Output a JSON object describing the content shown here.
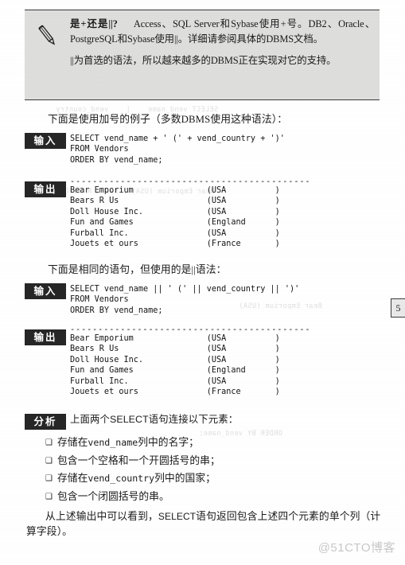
{
  "note": {
    "icon": "pencil-icon",
    "title": "是+还是||?",
    "paragraph_1": "Access、SQL Server和Sybase使用+号。DB2、Oracle、PostgreSQL和Sybase使用||。详细请参阅具体的DBMS文档。",
    "paragraph_2": "||为首选的语法，所以越来越多的DBMS正在实现对它的支持。",
    "background_color": "#dededd"
  },
  "sections": [
    {
      "intro": "下面是使用加号的例子（多数DBMS使用这种语法）：",
      "input_label": "输入",
      "input_code": "SELECT vend_name + ' (' + vend_country + ')'\nFROM Vendors\nORDER BY vend_name;",
      "output_label": "输出",
      "output_rule": "-------------------------------------------",
      "output_rows": [
        {
          "name": "Bear Emporium",
          "country": "(USA"
        },
        {
          "name": "Bears R Us",
          "country": "(USA"
        },
        {
          "name": "Doll House Inc.",
          "country": "(USA"
        },
        {
          "name": "Fun and Games",
          "country": "(England"
        },
        {
          "name": "Furball Inc.",
          "country": "(USA"
        },
        {
          "name": "Jouets et ours",
          "country": "(France"
        }
      ],
      "output_close": ")"
    },
    {
      "intro": "下面是相同的语句，但使用的是||语法：",
      "input_label": "输入",
      "input_code": "SELECT vend_name || ' (' || vend_country || ')'\nFROM Vendors\nORDER BY vend_name;",
      "output_label": "输出",
      "output_rule": "-------------------------------------------",
      "output_rows": [
        {
          "name": "Bear Emporium",
          "country": "(USA"
        },
        {
          "name": "Bears R Us",
          "country": "(USA"
        },
        {
          "name": "Doll House Inc.",
          "country": "(USA"
        },
        {
          "name": "Fun and Games",
          "country": "(England"
        },
        {
          "name": "Furball Inc.",
          "country": "(USA"
        },
        {
          "name": "Jouets et ours",
          "country": "(France"
        }
      ],
      "output_close": ")"
    }
  ],
  "analysis": {
    "label": "分析",
    "lead": "上面两个SELECT语句连接以下元素：",
    "bullet_mark": "❑",
    "items": [
      {
        "pre": "存储在",
        "code": "vend_name",
        "post": "列中的名字；"
      },
      {
        "pre": "包含一个空格和一个开圆括号的串；",
        "code": "",
        "post": ""
      },
      {
        "pre": "存储在",
        "code": "vend_country",
        "post": "列中的国家；"
      },
      {
        "pre": "包含一个闭圆括号的串。",
        "code": "",
        "post": ""
      }
    ]
  },
  "closing": {
    "line_1_a": "从上述输出中可以看到，",
    "line_1_code": "SELECT",
    "line_1_b": "语句返回包含上述四个元素的单个",
    "line_2": "列（计算字段）。"
  },
  "page_tab": {
    "number": "5"
  },
  "watermark": {
    "text": "@51CTO博客"
  }
}
